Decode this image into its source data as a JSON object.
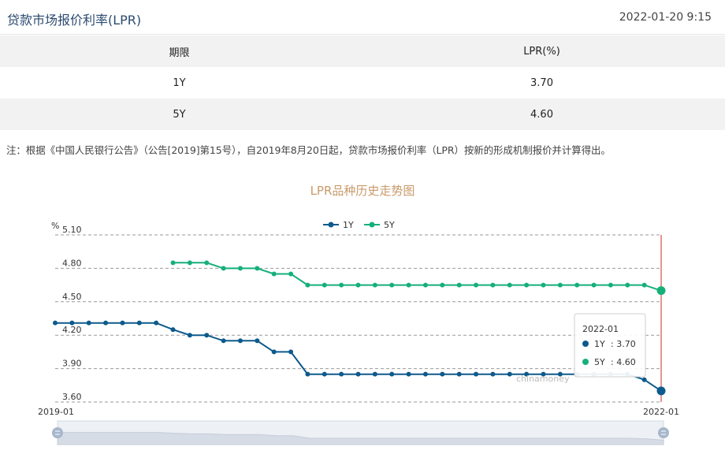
{
  "header": {
    "title": "贷款市场报价利率(LPR)",
    "timestamp": "2022-01-20 9:15"
  },
  "table": {
    "headers": [
      "期限",
      "LPR(%)"
    ],
    "rows": [
      {
        "term": "1Y",
        "rate": "3.70"
      },
      {
        "term": "5Y",
        "rate": "4.60"
      }
    ]
  },
  "note": "注：根据《中国人民银行公告》（公告[2019]第15号），自2019年8月20日起，贷款市场报价利率（LPR）按新的形成机制报价并计算得出。",
  "watermark": "chinamoney",
  "tooltip": {
    "title": "2022-01",
    "items": [
      {
        "name": "1Y",
        "value": "3.70",
        "color": "#0d5a8c"
      },
      {
        "name": "5Y",
        "value": "4.60",
        "color": "#15b07a"
      }
    ]
  },
  "chart_data": {
    "type": "line",
    "title": "LPR品种历史走势图",
    "ylabel": "%",
    "ylim": [
      3.6,
      5.1
    ],
    "yticks": [
      "5.10",
      "4.80",
      "4.50",
      "4.20",
      "3.90",
      "3.60"
    ],
    "x_axis_labels": [
      "2019-01",
      "2022-01"
    ],
    "x": [
      "2019-01",
      "2019-02",
      "2019-03",
      "2019-04",
      "2019-05",
      "2019-06",
      "2019-07",
      "2019-08",
      "2019-09",
      "2019-10",
      "2019-11",
      "2019-12",
      "2020-01",
      "2020-02",
      "2020-03",
      "2020-04",
      "2020-05",
      "2020-06",
      "2020-07",
      "2020-08",
      "2020-09",
      "2020-10",
      "2020-11",
      "2020-12",
      "2021-01",
      "2021-02",
      "2021-03",
      "2021-04",
      "2021-05",
      "2021-06",
      "2021-07",
      "2021-08",
      "2021-09",
      "2021-10",
      "2021-11",
      "2021-12",
      "2022-01"
    ],
    "legend_position": "top-center",
    "grid": true,
    "series": [
      {
        "name": "1Y",
        "color": "#0d5a8c",
        "values": [
          4.31,
          4.31,
          4.31,
          4.31,
          4.31,
          4.31,
          4.31,
          4.25,
          4.2,
          4.2,
          4.15,
          4.15,
          4.15,
          4.05,
          4.05,
          3.85,
          3.85,
          3.85,
          3.85,
          3.85,
          3.85,
          3.85,
          3.85,
          3.85,
          3.85,
          3.85,
          3.85,
          3.85,
          3.85,
          3.85,
          3.85,
          3.85,
          3.85,
          3.85,
          3.85,
          3.8,
          3.7
        ]
      },
      {
        "name": "5Y",
        "color": "#15b07a",
        "values": [
          null,
          null,
          null,
          null,
          null,
          null,
          null,
          4.85,
          4.85,
          4.85,
          4.8,
          4.8,
          4.8,
          4.75,
          4.75,
          4.65,
          4.65,
          4.65,
          4.65,
          4.65,
          4.65,
          4.65,
          4.65,
          4.65,
          4.65,
          4.65,
          4.65,
          4.65,
          4.65,
          4.65,
          4.65,
          4.65,
          4.65,
          4.65,
          4.65,
          4.65,
          4.6
        ]
      }
    ]
  }
}
